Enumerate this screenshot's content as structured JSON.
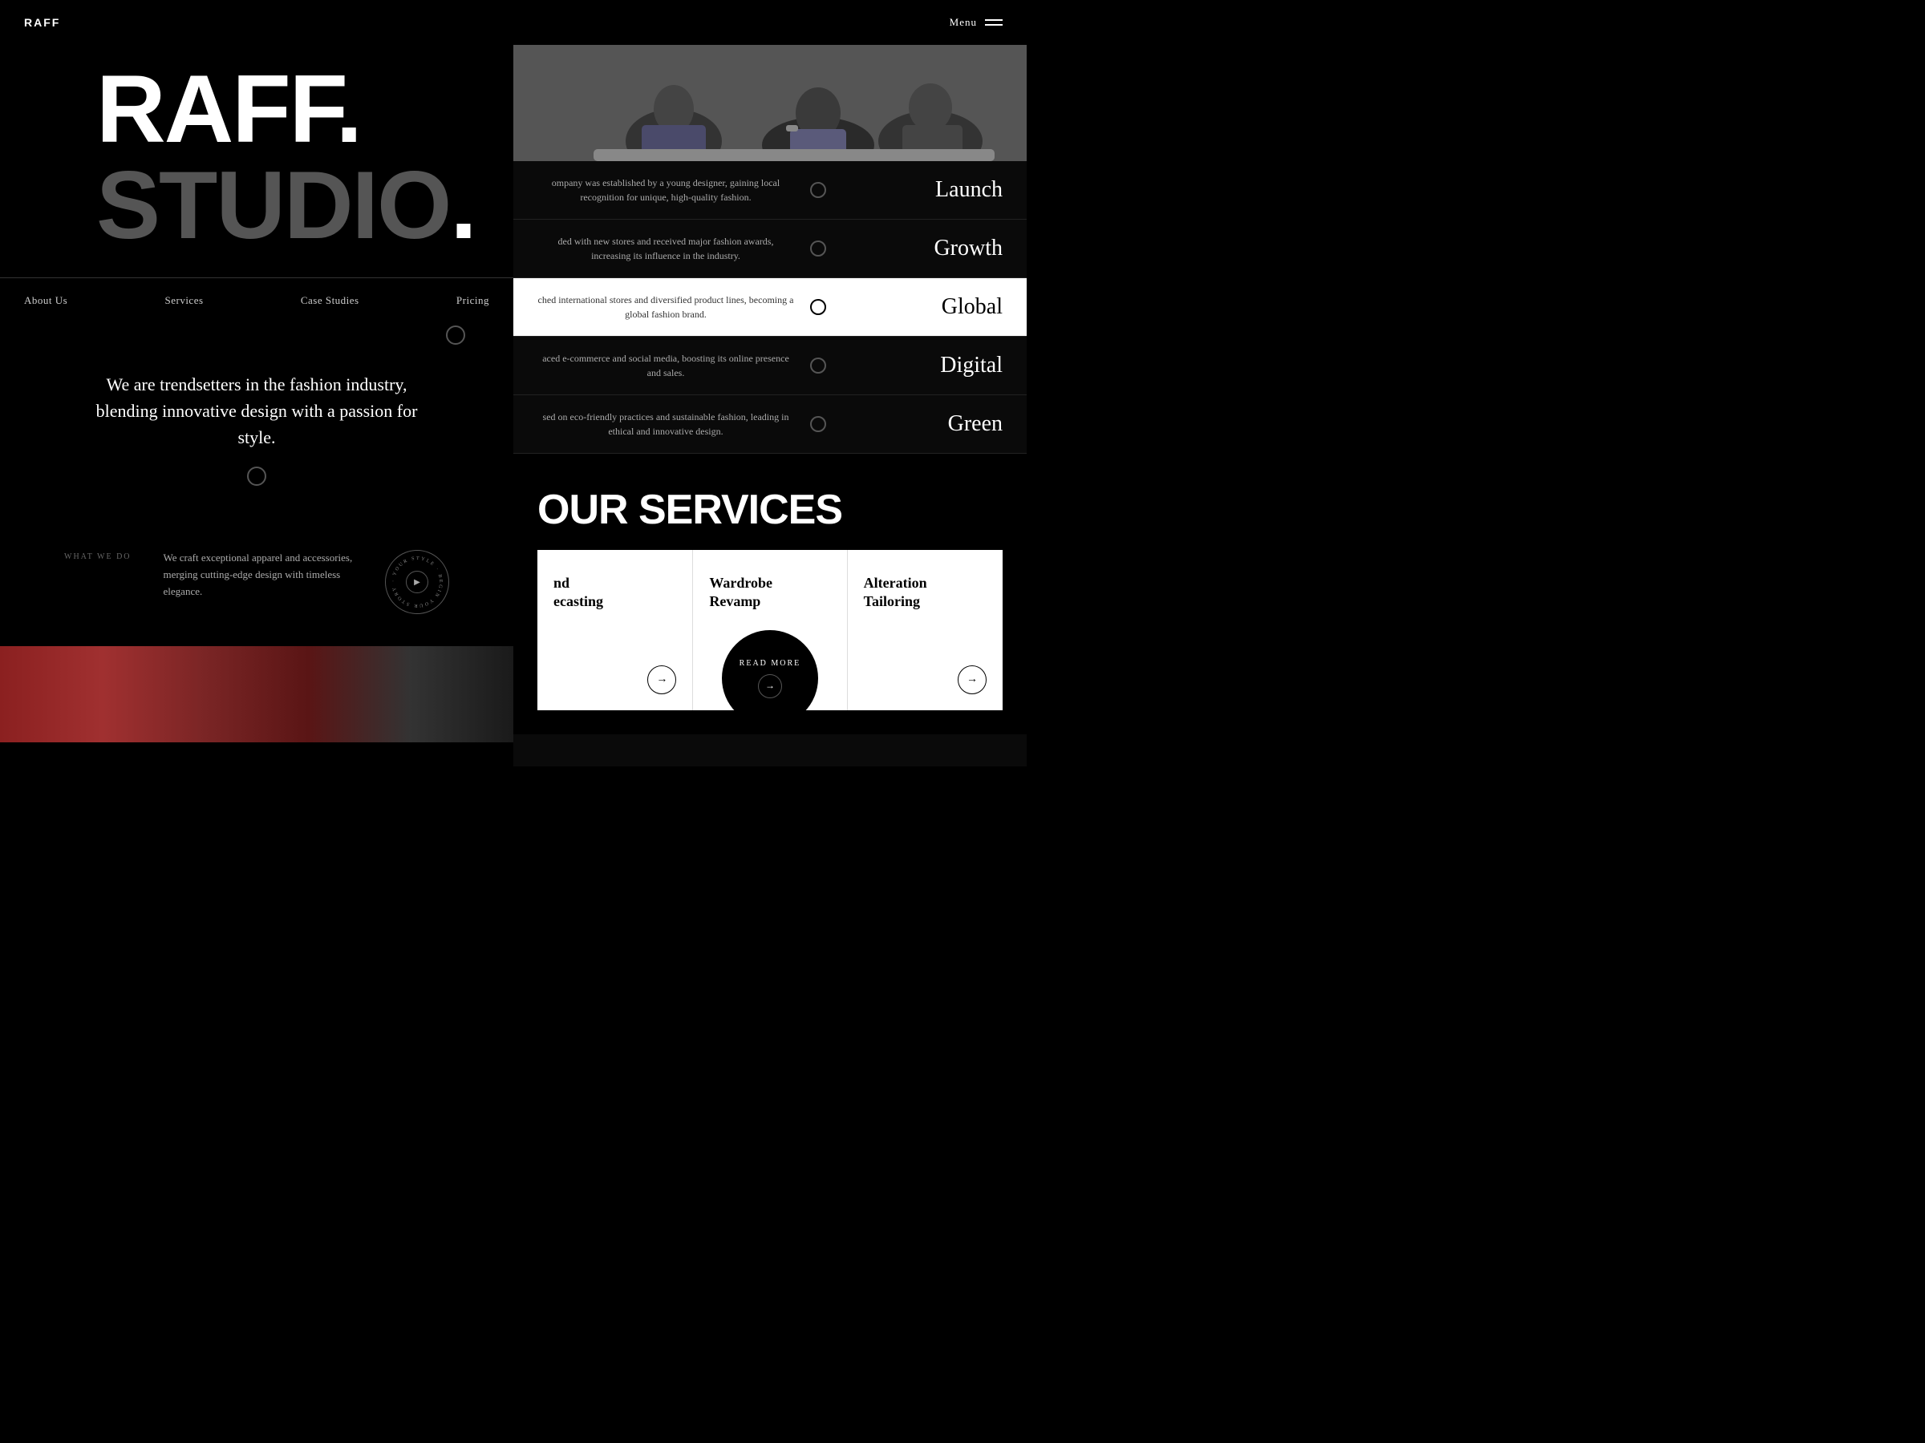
{
  "header": {
    "logo": "RAFF",
    "menu_label": "Menu"
  },
  "hero": {
    "title_white": "RAFF.",
    "title_gray": "STUDIO",
    "title_dot": "."
  },
  "nav": {
    "items": [
      {
        "label": "About Us",
        "id": "about"
      },
      {
        "label": "Services",
        "id": "services"
      },
      {
        "label": "Case Studies",
        "id": "case-studies"
      },
      {
        "label": "Pricing",
        "id": "pricing"
      }
    ]
  },
  "description": {
    "text": "We are trendsetters in the fashion industry, blending innovative design with a passion for style."
  },
  "what_we_do": {
    "label": "WHAT WE DO",
    "description": "We craft exceptional apparel and accessories, merging cutting-edge design with timeless elegance.",
    "badge_text": "· YOUR STYLE · BEGIN YOUR STORY ·"
  },
  "timeline": {
    "intro": "ompany was established by a young designer, gaining local recognition for unique, high-quality fashion.",
    "items": [
      {
        "desc": "ompany was established by a young designer, gaining local recognition for unique, high-quality fashion.",
        "label": "Launch",
        "active": false
      },
      {
        "desc": "ded with new stores and received major fashion awards, increasing its influence in the industry.",
        "label": "Growth",
        "active": false
      },
      {
        "desc": "ched international stores and diversified product lines, becoming a global fashion brand.",
        "label": "Global",
        "active": true
      },
      {
        "desc": "aced e-commerce and social media, boosting its online presence and sales.",
        "label": "Digital",
        "active": false
      },
      {
        "desc": "sed on eco-friendly practices and sustainable fashion, leading in ethical and innovative design.",
        "label": "Green",
        "active": false
      }
    ]
  },
  "services": {
    "title": "OUR SERVICES",
    "cards": [
      {
        "name": "Trend Forecasting",
        "name_partial": "nd\necasting"
      },
      {
        "name": "Wardrobe Revamp",
        "has_read_more": true
      },
      {
        "name": "Alteration & Tailoring",
        "name_partial": "Alteration\nTailoring"
      }
    ],
    "read_more": "READ MORE"
  }
}
